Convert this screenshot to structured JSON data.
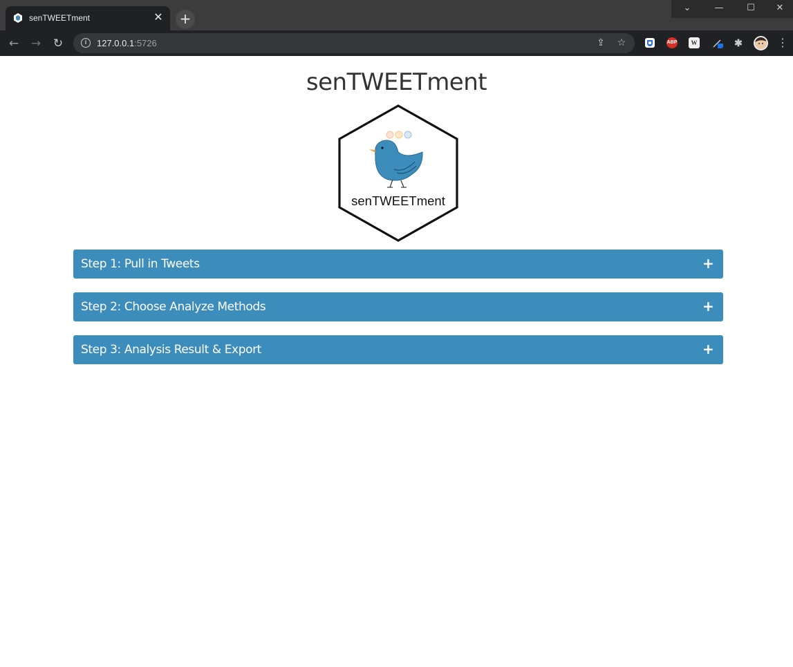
{
  "browser": {
    "tab": {
      "title": "senTWEETment",
      "close": "✕",
      "favicon": "hexagon-app-icon"
    },
    "new_tab": "+",
    "window_controls": {
      "tabsearch": "⌄",
      "minimize": "—",
      "maximize": "☐",
      "close": "✕"
    },
    "nav": {
      "back": "←",
      "forward": "→",
      "reload": "↻"
    },
    "omnibox": {
      "host": "127.0.0.1",
      "port": ":5726",
      "info": "i",
      "share": "⇪",
      "star": "☆"
    },
    "extensions": {
      "abp": "ABP",
      "w": "W",
      "puzzle": "✱"
    },
    "menu": "⋮"
  },
  "page": {
    "title": "senTWEETment",
    "logo": {
      "text": "senTWEETment",
      "bird_color": "#3c8dbc"
    },
    "accent_color": "#3c8dbc",
    "panels": [
      {
        "title": "Step 1: Pull in Tweets",
        "toggle": "+"
      },
      {
        "title": "Step 2: Choose Analyze Methods",
        "toggle": "+"
      },
      {
        "title": "Step 3: Analysis Result & Export",
        "toggle": "+"
      }
    ]
  }
}
